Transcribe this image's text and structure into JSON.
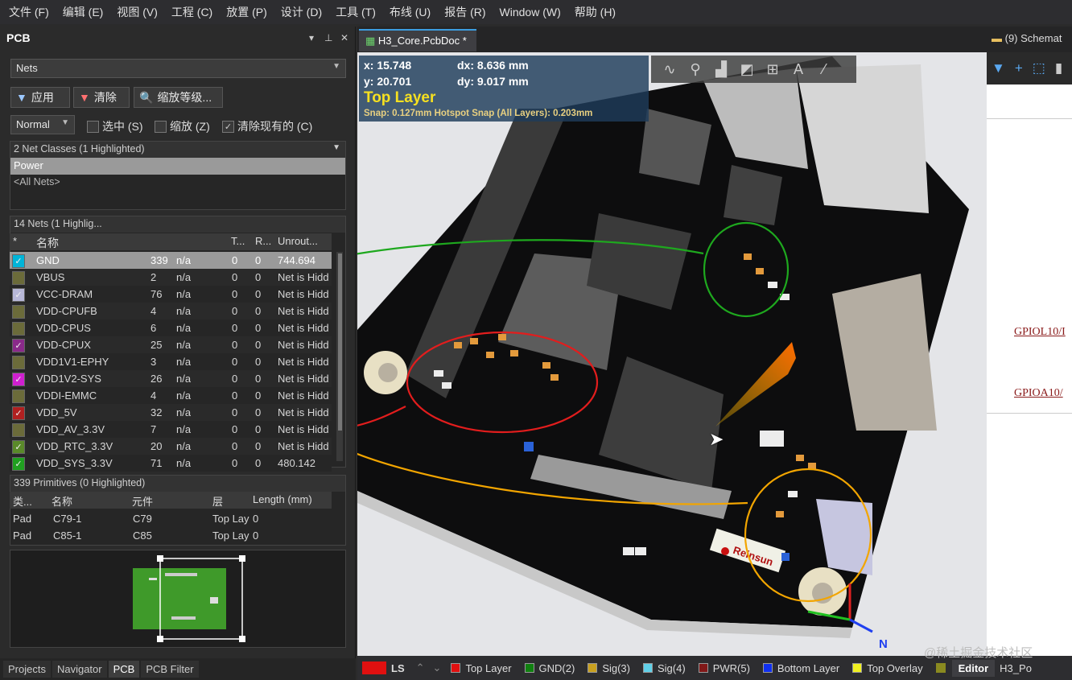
{
  "menu": [
    "文件 (F)",
    "编辑 (E)",
    "视图 (V)",
    "工程 (C)",
    "放置 (P)",
    "设计 (D)",
    "工具 (T)",
    "布线 (U)",
    "报告 (R)",
    "Window (W)",
    "帮助 (H)"
  ],
  "panel": {
    "title": "PCB",
    "controls": [
      "▾",
      "⏚",
      "✕"
    ],
    "filter_mode": "Nets",
    "buttons": {
      "apply": "应用",
      "clear": "清除",
      "zoom": "缩放等级..."
    },
    "mode": "Normal",
    "opts": {
      "select": "选中 (S)",
      "zoom": "缩放 (Z)",
      "clear_existing": "清除现有的 (C)"
    },
    "net_classes": {
      "header": "2 Net Classes (1 Highlighted)",
      "items": [
        "Power",
        "<All Nets>"
      ]
    },
    "nets": {
      "header": "14 Nets (1 Highlig...",
      "columns": [
        "*",
        "名称",
        "",
        "T...",
        "R...",
        "Unrout..."
      ],
      "rows": [
        {
          "color": "#00b4d8",
          "checked": true,
          "name": "GND",
          "nodes": "339",
          "len": "n/a",
          "t": "0",
          "r": "0",
          "unrouted": "744.694"
        },
        {
          "color": "#6b6b3a",
          "checked": false,
          "name": "VBUS",
          "nodes": "2",
          "len": "n/a",
          "t": "0",
          "r": "0",
          "unrouted": "Net is Hidd"
        },
        {
          "color": "#b8b8d8",
          "checked": true,
          "name": "VCC-DRAM",
          "nodes": "76",
          "len": "n/a",
          "t": "0",
          "r": "0",
          "unrouted": "Net is Hidd"
        },
        {
          "color": "#6b6b3a",
          "checked": false,
          "name": "VDD-CPUFB",
          "nodes": "4",
          "len": "n/a",
          "t": "0",
          "r": "0",
          "unrouted": "Net is Hidd"
        },
        {
          "color": "#6b6b3a",
          "checked": false,
          "name": "VDD-CPUS",
          "nodes": "6",
          "len": "n/a",
          "t": "0",
          "r": "0",
          "unrouted": "Net is Hidd"
        },
        {
          "color": "#8a2a8a",
          "checked": true,
          "name": "VDD-CPUX",
          "nodes": "25",
          "len": "n/a",
          "t": "0",
          "r": "0",
          "unrouted": "Net is Hidd"
        },
        {
          "color": "#6b6b3a",
          "checked": false,
          "name": "VDD1V1-EPHY",
          "nodes": "3",
          "len": "n/a",
          "t": "0",
          "r": "0",
          "unrouted": "Net is Hidd"
        },
        {
          "color": "#d020d0",
          "checked": true,
          "name": "VDD1V2-SYS",
          "nodes": "26",
          "len": "n/a",
          "t": "0",
          "r": "0",
          "unrouted": "Net is Hidd"
        },
        {
          "color": "#6b6b3a",
          "checked": false,
          "name": "VDDI-EMMC",
          "nodes": "4",
          "len": "n/a",
          "t": "0",
          "r": "0",
          "unrouted": "Net is Hidd"
        },
        {
          "color": "#b02020",
          "checked": true,
          "name": "VDD_5V",
          "nodes": "32",
          "len": "n/a",
          "t": "0",
          "r": "0",
          "unrouted": "Net is Hidd"
        },
        {
          "color": "#6b6b3a",
          "checked": false,
          "name": "VDD_AV_3.3V",
          "nodes": "7",
          "len": "n/a",
          "t": "0",
          "r": "0",
          "unrouted": "Net is Hidd"
        },
        {
          "color": "#5a8a2a",
          "checked": true,
          "name": "VDD_RTC_3.3V",
          "nodes": "20",
          "len": "n/a",
          "t": "0",
          "r": "0",
          "unrouted": "Net is Hidd"
        },
        {
          "color": "#20a020",
          "checked": true,
          "name": "VDD_SYS_3.3V",
          "nodes": "71",
          "len": "n/a",
          "t": "0",
          "r": "0",
          "unrouted": "480.142"
        }
      ]
    },
    "primitives": {
      "header": "339 Primitives (0 Highlighted)",
      "columns": [
        "类...",
        "名称",
        "元件",
        "层",
        "Length (mm)"
      ],
      "rows": [
        {
          "kind": "Pad",
          "name": "C79-1",
          "comp": "C79",
          "layer": "Top Lay",
          "len": "0"
        },
        {
          "kind": "Pad",
          "name": "C85-1",
          "comp": "C85",
          "layer": "Top Lay",
          "len": "0"
        }
      ]
    },
    "bottom_tabs": [
      "Projects",
      "Navigator",
      "PCB",
      "PCB Filter"
    ]
  },
  "doc": {
    "tab": "H3_Core.PcbDoc *",
    "right_tab": "(9) Schemat"
  },
  "hud": {
    "x": "x: 15.748",
    "dx": "dx:  8.636  mm",
    "y": "y: 20.701",
    "dy": "dy:  9.017  mm",
    "layer": "Top Layer",
    "snap": "Snap: 0.127mm Hotspot Snap (All Layers): 0.203mm"
  },
  "board": {
    "silk": "Reinsun"
  },
  "schematic": {
    "labels": [
      "GPIOL10/I",
      "GPIOA10/"
    ]
  },
  "status": {
    "ls": "LS",
    "layers": [
      {
        "name": "Top Layer",
        "color": "#e01010"
      },
      {
        "name": "GND(2)",
        "color": "#108010"
      },
      {
        "name": "Sig(3)",
        "color": "#c8a020"
      },
      {
        "name": "Sig(4)",
        "color": "#60d0e8"
      },
      {
        "name": "PWR(5)",
        "color": "#801818"
      },
      {
        "name": "Bottom Layer",
        "color": "#1030f0"
      },
      {
        "name": "Top Overlay",
        "color": "#f0f020"
      }
    ],
    "editor": "Editor",
    "doc2": "H3_Po"
  },
  "watermark": "@稀土掘金技术社区",
  "colors": {
    "accent": "#3c6e9e",
    "highlight": "#f2d020"
  }
}
